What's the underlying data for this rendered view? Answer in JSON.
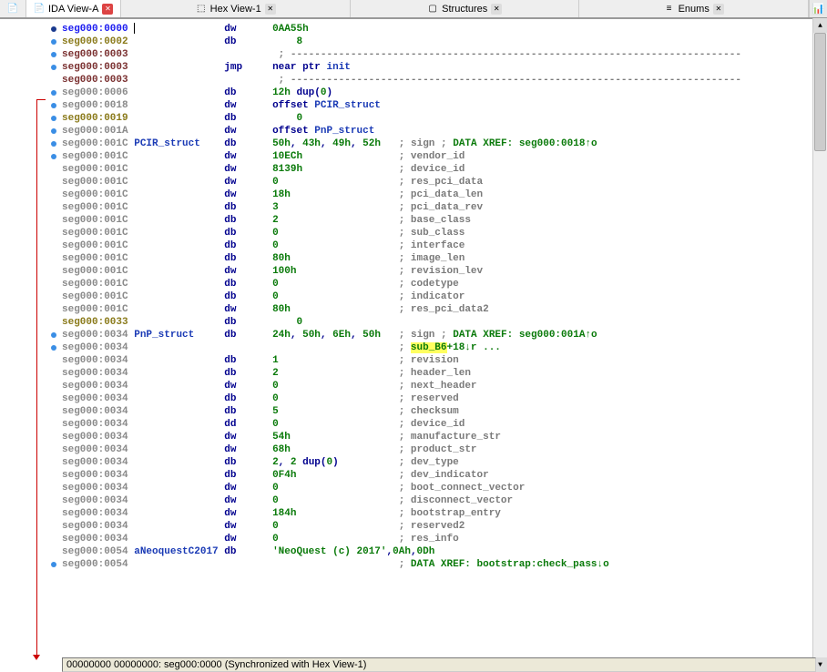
{
  "tabs": [
    {
      "label": "IDA View-A",
      "active": true,
      "icon": "📄"
    },
    {
      "label": "Hex View-1",
      "active": false,
      "icon": "⬚"
    },
    {
      "label": "Structures",
      "active": false,
      "icon": "▢"
    },
    {
      "label": "Enums",
      "active": false,
      "icon": "≡"
    }
  ],
  "gutter_dots": [
    {
      "row": 0,
      "class": "darkblue"
    },
    {
      "row": 1
    },
    {
      "row": 2
    },
    {
      "row": 3
    },
    {
      "row": 5
    },
    {
      "row": 6
    },
    {
      "row": 7
    },
    {
      "row": 8
    },
    {
      "row": 9
    },
    {
      "row": 10
    },
    {
      "row": 24
    },
    {
      "row": 25
    },
    {
      "row": 42
    }
  ],
  "lines": [
    {
      "addr": "seg000:0000",
      "cls": "addr-blue",
      "cursor": true,
      "cols": [
        "",
        "dw",
        "0AA55h"
      ]
    },
    {
      "addr": "seg000:0002",
      "cls": "addr-olive",
      "cols": [
        "",
        "db",
        "    8"
      ]
    },
    {
      "addr": "seg000:0003",
      "cls": "addr-red",
      "sep": true,
      "cols": [
        "",
        ";",
        "---------------------------------------------------------------------------"
      ]
    },
    {
      "addr": "seg000:0003",
      "cls": "addr-red",
      "cols": [
        "",
        "jmp",
        "near ptr init"
      ]
    },
    {
      "addr": "seg000:0003",
      "cls": "addr-red",
      "sep": true,
      "cols": [
        "",
        ";",
        "---------------------------------------------------------------------------"
      ]
    },
    {
      "addr": "seg000:0006",
      "cls": "addr-gray",
      "cols": [
        "",
        "db",
        "12h dup(0)"
      ]
    },
    {
      "addr": "seg000:0018",
      "cls": "addr-gray",
      "cols": [
        "",
        "dw",
        "offset PCIR_struct"
      ]
    },
    {
      "addr": "seg000:0019",
      "cls": "addr-olive",
      "cols": [
        "",
        "db",
        "    0"
      ]
    },
    {
      "addr": "seg000:001A",
      "cls": "addr-gray",
      "cols": [
        "",
        "dw",
        "offset PnP_struct"
      ]
    },
    {
      "addr": "seg000:001C",
      "cls": "addr-gray",
      "label": "PCIR_struct",
      "cols": [
        "",
        "db",
        "50h, 43h, 49h, 52h"
      ],
      "comment": "sign",
      "xref": "DATA XREF: seg000:0018↑o"
    },
    {
      "addr": "seg000:001C",
      "cls": "addr-gray",
      "cols": [
        "",
        "dw",
        "10ECh"
      ],
      "comment": "vendor_id"
    },
    {
      "addr": "seg000:001C",
      "cls": "addr-gray",
      "cols": [
        "",
        "dw",
        "8139h"
      ],
      "comment": "device_id"
    },
    {
      "addr": "seg000:001C",
      "cls": "addr-gray",
      "cols": [
        "",
        "dw",
        "0"
      ],
      "comment": "res_pci_data"
    },
    {
      "addr": "seg000:001C",
      "cls": "addr-gray",
      "cols": [
        "",
        "dw",
        "18h"
      ],
      "comment": "pci_data_len"
    },
    {
      "addr": "seg000:001C",
      "cls": "addr-gray",
      "cols": [
        "",
        "db",
        "3"
      ],
      "comment": "pci_data_rev"
    },
    {
      "addr": "seg000:001C",
      "cls": "addr-gray",
      "cols": [
        "",
        "db",
        "2"
      ],
      "comment": "base_class"
    },
    {
      "addr": "seg000:001C",
      "cls": "addr-gray",
      "cols": [
        "",
        "db",
        "0"
      ],
      "comment": "sub_class"
    },
    {
      "addr": "seg000:001C",
      "cls": "addr-gray",
      "cols": [
        "",
        "db",
        "0"
      ],
      "comment": "interface"
    },
    {
      "addr": "seg000:001C",
      "cls": "addr-gray",
      "cols": [
        "",
        "db",
        "80h"
      ],
      "comment": "image_len"
    },
    {
      "addr": "seg000:001C",
      "cls": "addr-gray",
      "cols": [
        "",
        "dw",
        "100h"
      ],
      "comment": "revision_lev"
    },
    {
      "addr": "seg000:001C",
      "cls": "addr-gray",
      "cols": [
        "",
        "db",
        "0"
      ],
      "comment": "codetype"
    },
    {
      "addr": "seg000:001C",
      "cls": "addr-gray",
      "cols": [
        "",
        "db",
        "0"
      ],
      "comment": "indicator"
    },
    {
      "addr": "seg000:001C",
      "cls": "addr-gray",
      "cols": [
        "",
        "dw",
        "80h"
      ],
      "comment": "res_pci_data2"
    },
    {
      "addr": "seg000:0033",
      "cls": "addr-olive",
      "cols": [
        "",
        "db",
        "    0"
      ]
    },
    {
      "addr": "seg000:0034",
      "cls": "addr-gray",
      "label": "PnP_struct",
      "cols": [
        "",
        "db",
        "24h, 50h, 6Eh, 50h"
      ],
      "comment": "sign",
      "xref": "DATA XREF: seg000:001A↑o"
    },
    {
      "addr": "seg000:0034",
      "cls": "addr-gray",
      "cols": [
        "",
        "",
        ""
      ],
      "comment": "",
      "hlxref": "sub_B6",
      "hlxref2": "+18↓r ..."
    },
    {
      "addr": "seg000:0034",
      "cls": "addr-gray",
      "cols": [
        "",
        "db",
        "1"
      ],
      "comment": "revision"
    },
    {
      "addr": "seg000:0034",
      "cls": "addr-gray",
      "cols": [
        "",
        "db",
        "2"
      ],
      "comment": "header_len"
    },
    {
      "addr": "seg000:0034",
      "cls": "addr-gray",
      "cols": [
        "",
        "dw",
        "0"
      ],
      "comment": "next_header"
    },
    {
      "addr": "seg000:0034",
      "cls": "addr-gray",
      "cols": [
        "",
        "db",
        "0"
      ],
      "comment": "reserved"
    },
    {
      "addr": "seg000:0034",
      "cls": "addr-gray",
      "cols": [
        "",
        "db",
        "5"
      ],
      "comment": "checksum"
    },
    {
      "addr": "seg000:0034",
      "cls": "addr-gray",
      "cols": [
        "",
        "dd",
        "0"
      ],
      "comment": "device_id"
    },
    {
      "addr": "seg000:0034",
      "cls": "addr-gray",
      "cols": [
        "",
        "dw",
        "54h"
      ],
      "comment": "manufacture_str"
    },
    {
      "addr": "seg000:0034",
      "cls": "addr-gray",
      "cols": [
        "",
        "dw",
        "68h"
      ],
      "comment": "product_str"
    },
    {
      "addr": "seg000:0034",
      "cls": "addr-gray",
      "cols": [
        "",
        "db",
        "2, 2 dup(0)"
      ],
      "comment": "dev_type"
    },
    {
      "addr": "seg000:0034",
      "cls": "addr-gray",
      "cols": [
        "",
        "db",
        "0F4h"
      ],
      "comment": "dev_indicator"
    },
    {
      "addr": "seg000:0034",
      "cls": "addr-gray",
      "cols": [
        "",
        "dw",
        "0"
      ],
      "comment": "boot_connect_vector"
    },
    {
      "addr": "seg000:0034",
      "cls": "addr-gray",
      "cols": [
        "",
        "dw",
        "0"
      ],
      "comment": "disconnect_vector"
    },
    {
      "addr": "seg000:0034",
      "cls": "addr-gray",
      "cols": [
        "",
        "dw",
        "184h"
      ],
      "comment": "bootstrap_entry"
    },
    {
      "addr": "seg000:0034",
      "cls": "addr-gray",
      "cols": [
        "",
        "dw",
        "0"
      ],
      "comment": "reserved2"
    },
    {
      "addr": "seg000:0034",
      "cls": "addr-gray",
      "cols": [
        "",
        "dw",
        "0"
      ],
      "comment": "res_info"
    },
    {
      "addr": "seg000:0054",
      "cls": "addr-gray",
      "label": "aNeoquestC2017",
      "cols": [
        "",
        "db",
        "'NeoQuest (c) 2017',0Ah,0Dh"
      ],
      "isstr": true
    },
    {
      "addr": "seg000:0054",
      "cls": "addr-gray",
      "cols": [
        "",
        "",
        ""
      ],
      "comment": "",
      "xref": "DATA XREF: bootstrap:check_pass↓o"
    }
  ],
  "status": "00000000 00000000: seg000:0000 (Synchronized with Hex View-1)"
}
